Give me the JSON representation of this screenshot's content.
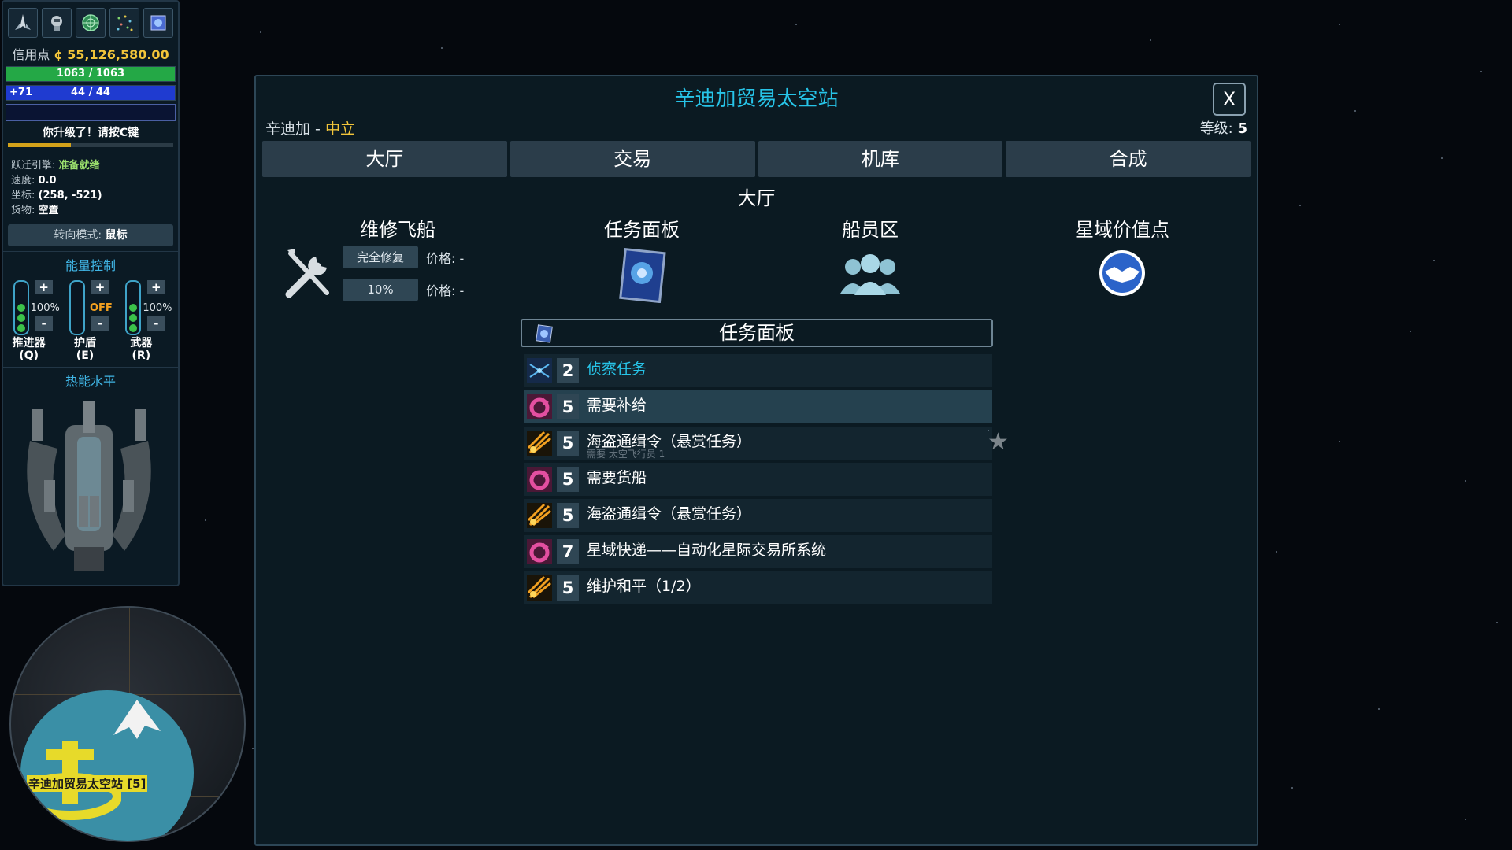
{
  "hud": {
    "top_icons": [
      "ship-icon",
      "pilot-icon",
      "radar-icon",
      "starmap-icon",
      "codex-icon"
    ],
    "credits_label": "信用点",
    "credits_value": "¢ 55,126,580.00",
    "hull": "1063 / 1063",
    "shield_bonus": "+71",
    "shield": "44 / 44",
    "level_up": "你升级了！请按C键",
    "xp_fraction": 0.38,
    "stats": {
      "jump_label": "跃迁引擎:",
      "jump_value": "准备就绪",
      "speed_label": "速度:",
      "speed_value": "0.0",
      "coords_label": "坐标:",
      "coords_value": "(258, -521)",
      "cargo_label": "货物:",
      "cargo_value": "空置"
    },
    "steer_label": "转向模式:",
    "steer_value": "鼠标",
    "energy_title": "能量控制",
    "energy": [
      {
        "name": "推进器",
        "key": "(Q)",
        "value": "100%"
      },
      {
        "name": "护盾",
        "key": "(E)",
        "value": "OFF"
      },
      {
        "name": "武器",
        "key": "(R)",
        "value": "100%"
      }
    ],
    "plus": "+",
    "minus": "-",
    "heat_title": "热能水平"
  },
  "minimap": {
    "station_label": "辛迪加贸易太空站 [5]"
  },
  "dialog": {
    "title": "辛迪加贸易太空站",
    "close": "X",
    "faction": "辛迪加",
    "separator": " - ",
    "standing": "中立",
    "level_label": "等级: ",
    "level_value": "5",
    "tabs": [
      "大厅",
      "交易",
      "机库",
      "合成"
    ],
    "subtitle": "大厅",
    "sections": {
      "repair": "维修飞船",
      "missions": "任务面板",
      "crew": "船员区",
      "value_point": "星域价值点"
    },
    "repair_full": "完全修复",
    "repair_partial": "10%",
    "price_full": "价格: -",
    "price_partial": "价格: -",
    "board_title": "任务面板",
    "missions": [
      {
        "icon": "recon-icon",
        "level": "2",
        "name": "侦察任务",
        "req": "",
        "link": true,
        "active": false,
        "star": false
      },
      {
        "icon": "supply-icon",
        "level": "5",
        "name": "需要补给",
        "req": "",
        "link": false,
        "active": true,
        "star": false
      },
      {
        "icon": "bounty-icon",
        "level": "5",
        "name": "海盗通缉令（悬赏任务）",
        "req": "需要 太空飞行员 1",
        "link": false,
        "active": false,
        "star": true
      },
      {
        "icon": "supply-icon",
        "level": "5",
        "name": "需要货船",
        "req": "",
        "link": false,
        "active": false,
        "star": false
      },
      {
        "icon": "bounty-icon",
        "level": "5",
        "name": "海盗通缉令（悬赏任务）",
        "req": "",
        "link": false,
        "active": false,
        "star": false
      },
      {
        "icon": "supply-icon",
        "level": "7",
        "name": "星域快递——自动化星际交易所系统",
        "req": "",
        "link": false,
        "active": false,
        "star": false
      },
      {
        "icon": "bounty-icon",
        "level": "5",
        "name": "维护和平（1/2）",
        "req": "",
        "link": false,
        "active": false,
        "star": false
      }
    ],
    "star_glyph": "★"
  },
  "colors": {
    "accent": "#27c4e8",
    "gold": "#f2c53a",
    "hull": "#24a846",
    "shield": "#1f3bd0"
  }
}
